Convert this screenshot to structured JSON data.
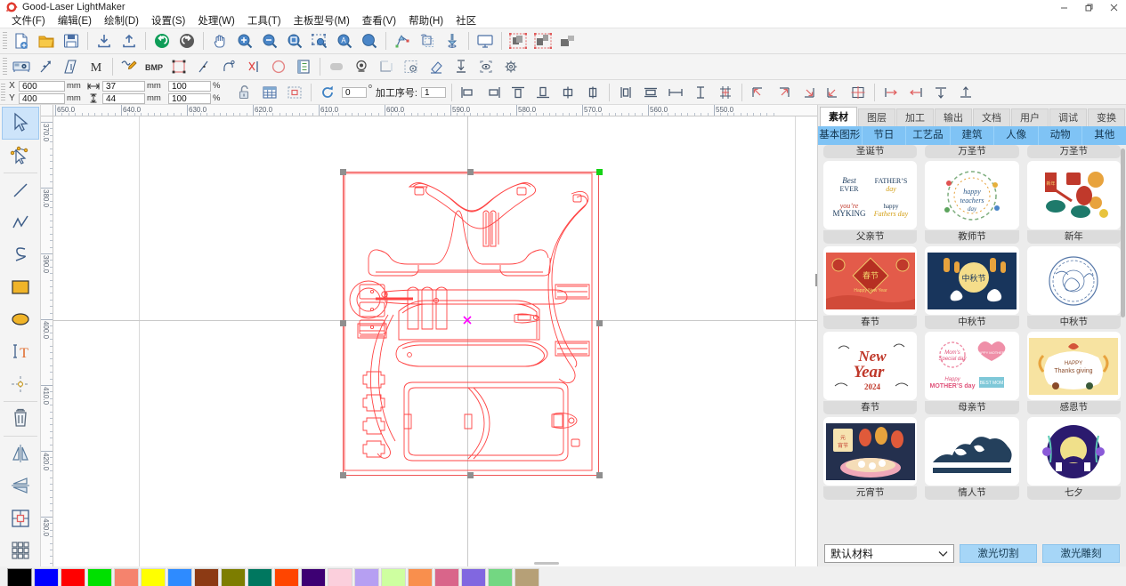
{
  "window": {
    "title": "Good-Laser LightMaker",
    "logo_icon": "gear-red-icon",
    "minimize_label": "–",
    "restore_label": "❐",
    "close_label": "✕"
  },
  "menubar": [
    {
      "label": "文件(F)",
      "name": "menu-file"
    },
    {
      "label": "编辑(E)",
      "name": "menu-edit"
    },
    {
      "label": "绘制(D)",
      "name": "menu-draw"
    },
    {
      "label": "设置(S)",
      "name": "menu-settings"
    },
    {
      "label": "处理(W)",
      "name": "menu-process"
    },
    {
      "label": "工具(T)",
      "name": "menu-tools"
    },
    {
      "label": "主板型号(M)",
      "name": "menu-board-model"
    },
    {
      "label": "查看(V)",
      "name": "menu-view"
    },
    {
      "label": "帮助(H)",
      "name": "menu-help"
    },
    {
      "label": "社区",
      "name": "menu-community"
    }
  ],
  "toolbar1": [
    {
      "icon": "new-file-icon"
    },
    {
      "icon": "open-folder-icon"
    },
    {
      "icon": "save-icon"
    },
    {
      "sep": true
    },
    {
      "icon": "import-icon"
    },
    {
      "icon": "export-icon"
    },
    {
      "sep": true
    },
    {
      "icon": "undo-icon"
    },
    {
      "icon": "redo-icon"
    },
    {
      "sep": true
    },
    {
      "icon": "pan-hand-icon"
    },
    {
      "icon": "zoom-in-icon"
    },
    {
      "icon": "zoom-out-icon"
    },
    {
      "icon": "zoom-fit-icon"
    },
    {
      "icon": "zoom-selection-icon"
    },
    {
      "icon": "zoom-all-icon"
    },
    {
      "icon": "zoom-page-icon"
    },
    {
      "sep": true
    },
    {
      "icon": "node-path-icon"
    },
    {
      "icon": "offset-icon"
    },
    {
      "icon": "laser-head-icon"
    },
    {
      "sep": true
    },
    {
      "icon": "preview-monitor-icon"
    },
    {
      "sep": true
    },
    {
      "icon": "group-icon"
    },
    {
      "icon": "ungroup-icon"
    },
    {
      "icon": "combine-icon"
    }
  ],
  "toolbar2": [
    {
      "icon": "machine-icon"
    },
    {
      "icon": "trace-arrow-icon"
    },
    {
      "icon": "measure-icon"
    },
    {
      "icon": "manual-m-icon"
    },
    {
      "sep": true
    },
    {
      "icon": "pen-draw-icon"
    },
    {
      "icon": "bmp-icon"
    },
    {
      "icon": "rect-node-icon"
    },
    {
      "icon": "line-node-icon"
    },
    {
      "icon": "curve-node-icon"
    },
    {
      "icon": "cut-node-icon"
    },
    {
      "icon": "circle-red-icon"
    },
    {
      "icon": "list-check-icon"
    },
    {
      "sep": true
    },
    {
      "icon": "fill-gray-icon"
    },
    {
      "icon": "target-icon"
    },
    {
      "icon": "frame-icon"
    },
    {
      "icon": "settings-frame-icon"
    },
    {
      "icon": "eraser-icon"
    },
    {
      "icon": "align-down-icon"
    },
    {
      "icon": "scan-icon"
    },
    {
      "icon": "gear-icon"
    }
  ],
  "property_bar": {
    "x_label": "X",
    "x_value": "600",
    "y_label": "Y",
    "y_value": "400",
    "unit_mm": "mm",
    "width_icon": "width-arrows-icon",
    "width_value": "37",
    "height_icon": "height-arrows-icon",
    "height_value": "44",
    "scale_x": "100",
    "scale_y": "100",
    "percent": "%",
    "lock_icon": "lock-open-icon",
    "grid_icon": "grid-icon",
    "bounds_icon": "bounding-box-icon",
    "rotate_icon": "rotate-icon",
    "rotate_value": "0",
    "degree_symbol": "o",
    "order_label": "加工序号:",
    "order_value": "1",
    "align_tools": [
      {
        "icon": "align-left-icon"
      },
      {
        "icon": "align-right-icon"
      },
      {
        "icon": "align-top-icon"
      },
      {
        "icon": "align-bottom-icon"
      },
      {
        "icon": "align-center-v-icon"
      },
      {
        "icon": "align-center-h-icon"
      },
      {
        "sep": true
      },
      {
        "icon": "same-width-icon"
      },
      {
        "icon": "same-height-icon"
      },
      {
        "icon": "distribute-h-icon"
      },
      {
        "icon": "distribute-v-icon"
      },
      {
        "icon": "same-size-icon"
      },
      {
        "sep": true
      },
      {
        "icon": "origin-top-left-icon"
      },
      {
        "icon": "origin-top-right-icon"
      },
      {
        "icon": "origin-bottom-right-icon"
      },
      {
        "icon": "origin-bottom-left-icon"
      },
      {
        "icon": "origin-center-icon"
      },
      {
        "sep": true
      },
      {
        "icon": "start-left-icon"
      },
      {
        "icon": "start-right-icon"
      },
      {
        "icon": "start-top-icon"
      },
      {
        "icon": "start-bottom-icon"
      }
    ]
  },
  "left_tools": [
    {
      "icon": "select-arrow-icon",
      "active": true
    },
    {
      "icon": "node-edit-icon",
      "active": false
    },
    {
      "sep": true
    },
    {
      "icon": "line-tool-icon",
      "active": false
    },
    {
      "icon": "polyline-tool-icon",
      "active": false
    },
    {
      "icon": "curve-tool-icon",
      "active": false
    },
    {
      "icon": "rectangle-tool-icon",
      "active": false
    },
    {
      "icon": "ellipse-tool-icon",
      "active": false
    },
    {
      "icon": "text-tool-icon",
      "active": false
    },
    {
      "icon": "point-tool-icon",
      "active": false
    },
    {
      "sep": true
    },
    {
      "icon": "delete-trash-icon",
      "active": false
    },
    {
      "sep": true
    },
    {
      "icon": "mirror-horizontal-icon",
      "active": false
    },
    {
      "icon": "mirror-vertical-icon",
      "active": false
    },
    {
      "icon": "array-center-icon",
      "active": false
    },
    {
      "icon": "array-grid-icon",
      "active": false
    }
  ],
  "canvas": {
    "ruler_h_labels": [
      "650.0",
      "640.0",
      "630.0",
      "620.0",
      "610.0",
      "600.0",
      "590.0",
      "580.0",
      "570.0",
      "560.0",
      "550.0"
    ],
    "ruler_v_labels": [
      "370.0",
      "380.0",
      "390.0",
      "400.0",
      "410.0",
      "420.0",
      "430.0"
    ],
    "origin_marker": "origin-cross-icon",
    "selection_handles": 8,
    "selection_active_handle": "top-right-green"
  },
  "right_panel": {
    "tabs": [
      {
        "label": "素材",
        "name": "tab-materials",
        "active": true
      },
      {
        "label": "图层",
        "name": "tab-layers",
        "active": false
      },
      {
        "label": "加工",
        "name": "tab-processing",
        "active": false
      },
      {
        "label": "输出",
        "name": "tab-output",
        "active": false
      },
      {
        "label": "文档",
        "name": "tab-document",
        "active": false
      },
      {
        "label": "用户",
        "name": "tab-user",
        "active": false
      },
      {
        "label": "调试",
        "name": "tab-debug",
        "active": false
      },
      {
        "label": "变换",
        "name": "tab-transform",
        "active": false
      }
    ],
    "subtabs": [
      {
        "label": "基本图形",
        "name": "subtab-basic-shapes",
        "active": true
      },
      {
        "label": "节日",
        "name": "subtab-holidays",
        "active": false
      },
      {
        "label": "工艺品",
        "name": "subtab-crafts",
        "active": false
      },
      {
        "label": "建筑",
        "name": "subtab-architecture",
        "active": false
      },
      {
        "label": "人像",
        "name": "subtab-portraits",
        "active": false
      },
      {
        "label": "动物",
        "name": "subtab-animals",
        "active": false
      },
      {
        "label": "其他",
        "name": "subtab-others",
        "active": false
      }
    ],
    "partial_top_row": [
      {
        "label": "圣诞节"
      },
      {
        "label": "万圣节"
      },
      {
        "label": "万圣节"
      }
    ],
    "items": [
      {
        "label": "父亲节",
        "thumb": "fathers-day-thumb"
      },
      {
        "label": "教师节",
        "thumb": "teachers-day-thumb"
      },
      {
        "label": "新年",
        "thumb": "new-year-thumb"
      },
      {
        "label": "春节",
        "thumb": "spring-festival-thumb"
      },
      {
        "label": "中秋节",
        "thumb": "mid-autumn-dark-thumb"
      },
      {
        "label": "中秋节",
        "thumb": "mid-autumn-line-thumb"
      },
      {
        "label": "春节",
        "thumb": "new-year-2024-thumb"
      },
      {
        "label": "母亲节",
        "thumb": "mothers-day-thumb"
      },
      {
        "label": "感恩节",
        "thumb": "thanksgiving-thumb"
      },
      {
        "label": "元宵节",
        "thumb": "lantern-festival-thumb"
      },
      {
        "label": "情人节",
        "thumb": "valentines-thumb"
      },
      {
        "label": "七夕",
        "thumb": "qixi-thumb"
      }
    ],
    "footer": {
      "material_select": "默认材料",
      "chevron": "⌄",
      "cut_button": "激光切割",
      "engrave_button": "激光雕刻"
    }
  },
  "palette": {
    "colors": [
      "#000000",
      "#0000ff",
      "#ff0000",
      "#00e000",
      "#f5836d",
      "#ffff00",
      "#2e8bff",
      "#8c3a14",
      "#7d7d00",
      "#00775f",
      "#ff4500",
      "#3d0073",
      "#fbcfdc",
      "#b69ff2",
      "#ceffa0",
      "#f98f4d",
      "#d9658a",
      "#8167e0",
      "#73d782",
      "#b6a077"
    ]
  }
}
